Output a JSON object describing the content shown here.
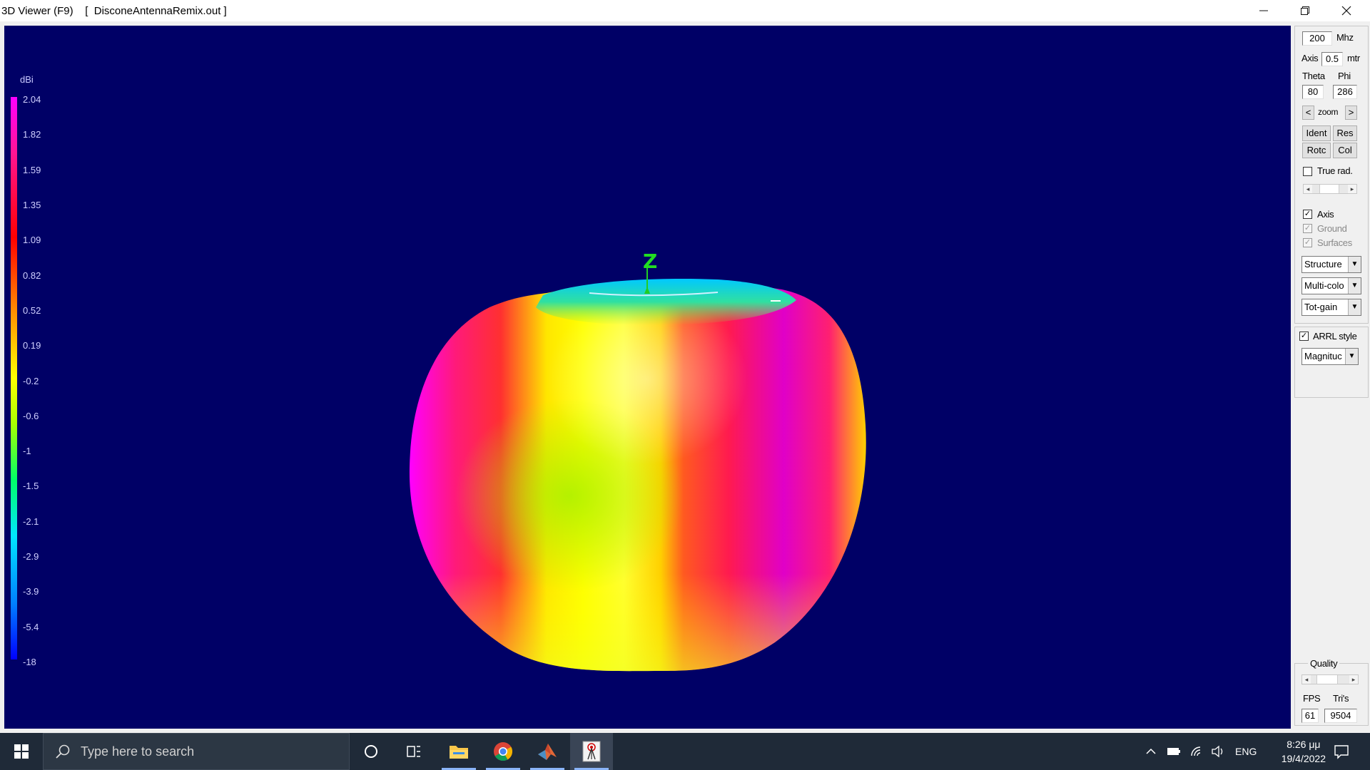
{
  "titlebar": {
    "app_title": "3D Viewer (F9)",
    "file_name": "[  DisconeAntennaRemix.out ]"
  },
  "viewport": {
    "background_color": "#000066",
    "axis_label": "Z",
    "legend": {
      "unit": "dBi",
      "labels": [
        "2.04",
        "1.82",
        "1.59",
        "1.35",
        "1.09",
        "0.82",
        "0.52",
        "0.19",
        "-0.2",
        "-0.6",
        "-1",
        "-1.5",
        "-2.1",
        "-2.9",
        "-3.9",
        "-5.4",
        "-18"
      ]
    }
  },
  "panel": {
    "frequency_value": "200",
    "frequency_unit": "Mhz",
    "axis_label": "Axis",
    "axis_value": "0.5",
    "axis_unit": "mtr",
    "theta_label": "Theta",
    "phi_label": "Phi",
    "theta_value": "80",
    "phi_value": "286",
    "zoom_prev": "<",
    "zoom_label": "zoom",
    "zoom_next": ">",
    "buttons": {
      "ident": "Ident",
      "res": "Res",
      "rotc": "Rotc",
      "col": "Col"
    },
    "true_rad_label": "True rad.",
    "true_rad_checked": false,
    "axis_check_label": "Axis",
    "axis_checked": true,
    "ground_label": "Ground",
    "ground_checked": true,
    "surfaces_label": "Surfaces",
    "surfaces_checked": true,
    "combo_structure": "Structure",
    "combo_color": "Multi-colo",
    "combo_gain": "Tot-gain",
    "arrl_label": "ARRL style",
    "arrl_checked": true,
    "combo_magnitude": "Magnituc",
    "quality_label": "Quality",
    "fps_label": "FPS",
    "tris_label": "Tri's",
    "fps_value": "61",
    "tris_value": "9504"
  },
  "taskbar": {
    "search_placeholder": "Type here to search",
    "language": "ENG",
    "time": "8:26 μμ",
    "date": "19/4/2022",
    "icons": [
      "windows-start-icon",
      "search-icon",
      "cortana-icon",
      "task-view-icon",
      "file-explorer-icon",
      "chrome-icon",
      "matlab-icon",
      "antenna-app-icon",
      "chevron-up-icon",
      "battery-icon",
      "wifi-icon",
      "volume-icon",
      "notification-icon"
    ]
  }
}
